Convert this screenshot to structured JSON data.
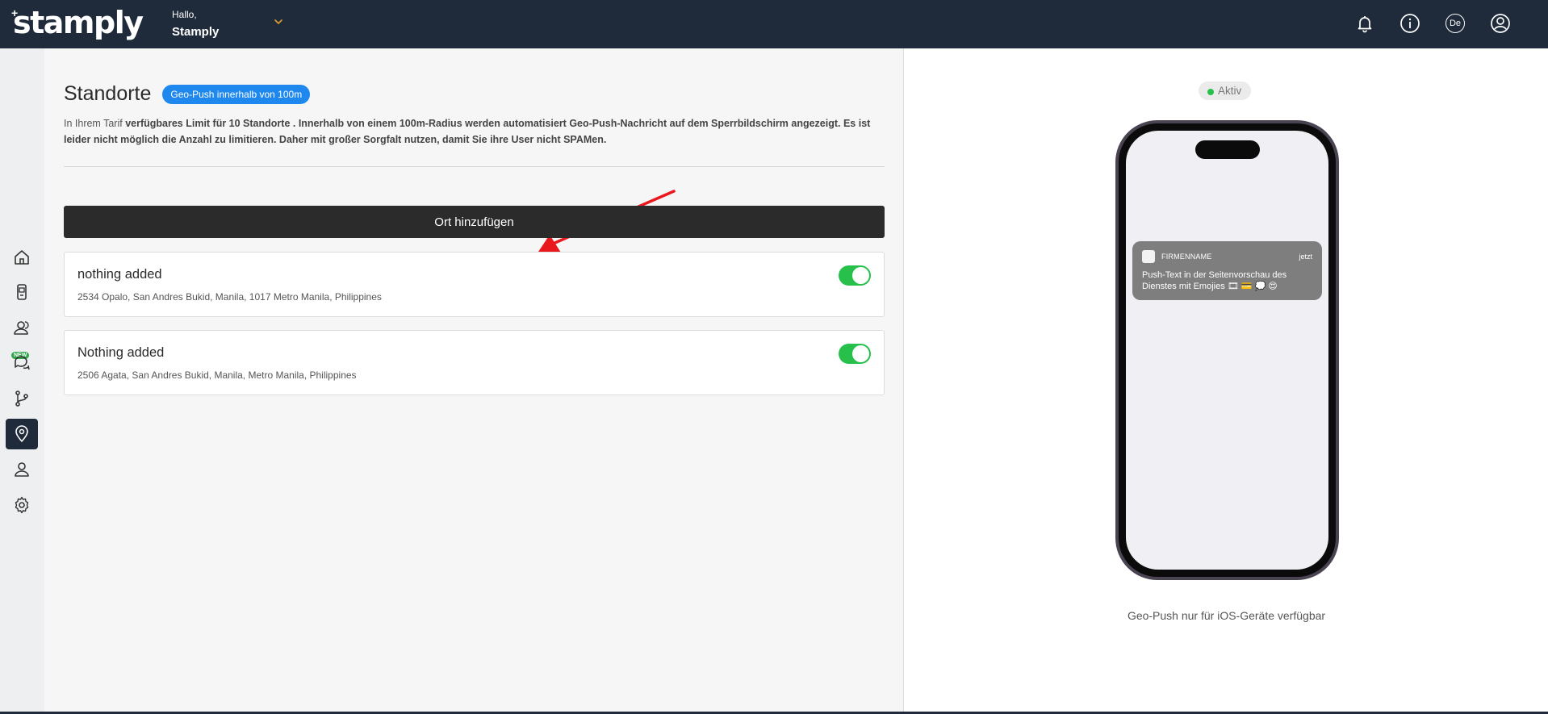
{
  "header": {
    "logo": "stamply",
    "greeting": "Hallo,",
    "user_name": "Stamply",
    "language": "De",
    "icons": [
      "bell-icon",
      "info-icon",
      "language-icon",
      "user-account-icon"
    ]
  },
  "sidebar": {
    "new_badge": "NEW",
    "items": [
      {
        "icon": "home-icon",
        "active": false
      },
      {
        "icon": "phone-card-icon",
        "active": false
      },
      {
        "icon": "customers-icon",
        "active": false
      },
      {
        "icon": "chat-icon",
        "active": false
      },
      {
        "icon": "flow-icon",
        "active": false
      },
      {
        "icon": "location-pin-icon",
        "active": true
      },
      {
        "icon": "user-icon",
        "active": false
      },
      {
        "icon": "settings-icon",
        "active": false
      }
    ]
  },
  "main": {
    "title": "Standorte",
    "badge": "Geo-Push innerhalb von 100m",
    "desc_prefix": "In Ihrem Tarif ",
    "desc_bold": "verfügbares Limit für 10 Standorte . Innerhalb von einem 100m-Radius werden automatisiert Geo-Push-Nachricht auf dem Sperrbildschirm angezeigt. Es ist leider nicht möglich die Anzahl zu limitieren. Daher mit großer Sorgfalt nutzen, damit Sie ihre User nicht SPAMen.",
    "add_button": "Ort hinzufügen",
    "locations": [
      {
        "title": "nothing added",
        "address": "2534 Opalo, San Andres Bukid, Manila, 1017 Metro Manila, Philippines",
        "enabled": true
      },
      {
        "title": "Nothing added",
        "address": "2506 Agata, San Andres Bukid, Manila, Metro Manila, Philippines",
        "enabled": true
      }
    ]
  },
  "preview": {
    "status": "Aktiv",
    "notification": {
      "app": "FIRMENNAME",
      "time": "jetzt",
      "text": "Push-Text in der Seitenvorschau des Dienstes mit Emojies 🎞 💳 💭 😍"
    },
    "caption": "Geo-Push nur für iOS-Geräte verfügbar"
  },
  "colors": {
    "topbar": "#1f2a3a",
    "badge_blue": "#1e88ee",
    "toggle_green": "#27c04a",
    "button_dark": "#2b2b2b",
    "annotation_arrow": "#e8181c"
  }
}
